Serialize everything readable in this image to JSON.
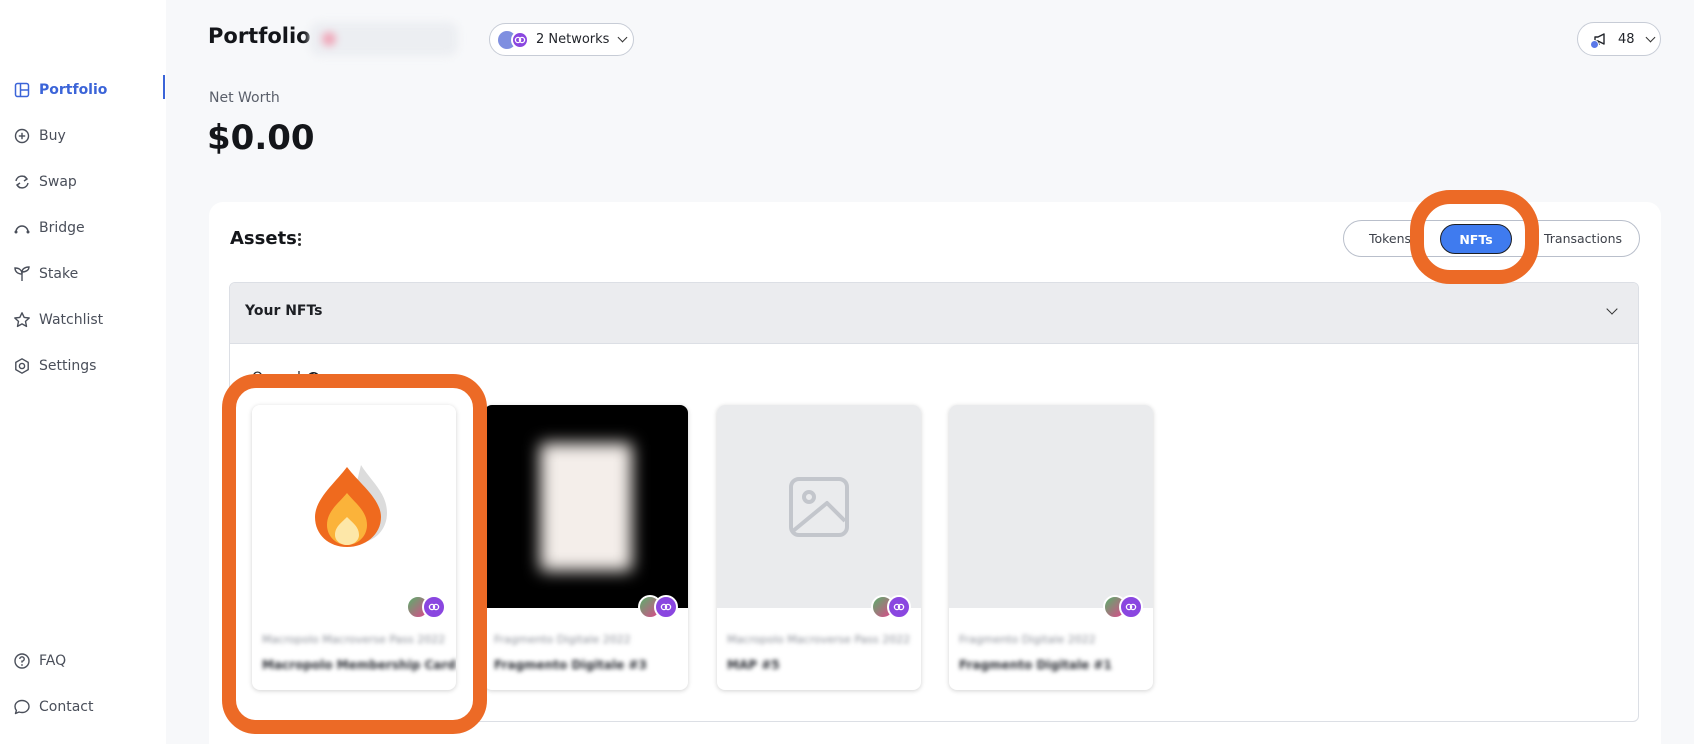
{
  "sidebar": {
    "items": [
      {
        "label": "Portfolio",
        "icon": "portfolio-icon",
        "active": true
      },
      {
        "label": "Buy",
        "icon": "plus-circle-icon"
      },
      {
        "label": "Swap",
        "icon": "swap-icon"
      },
      {
        "label": "Bridge",
        "icon": "bridge-icon"
      },
      {
        "label": "Stake",
        "icon": "sprout-icon"
      },
      {
        "label": "Watchlist",
        "icon": "star-icon"
      },
      {
        "label": "Settings",
        "icon": "gear-icon"
      }
    ],
    "bottom_items": [
      {
        "label": "FAQ",
        "icon": "question-circle-icon"
      },
      {
        "label": "Contact",
        "icon": "chat-bubble-icon"
      }
    ]
  },
  "header": {
    "title": "Portfolio",
    "networks_label": "2 Networks",
    "notifications_count": "48"
  },
  "net_worth": {
    "label": "Net Worth",
    "value": "$0.00"
  },
  "assets": {
    "title": "Assets",
    "tabs": [
      {
        "label": "Tokens"
      },
      {
        "label": "NFTs",
        "active": true
      },
      {
        "label": "Transactions"
      }
    ],
    "section_title": "Your NFTs",
    "owned_label": "Owned",
    "owned_count": "4",
    "nfts": [
      {
        "collection": "Macropolo Macroverse Pass 2022",
        "name": "Macropolo Membership Card",
        "image": "flame-logo"
      },
      {
        "collection": "Fragmento Digitale 2022",
        "name": "Fragmento Digitale #3",
        "image": "blurred-artwork"
      },
      {
        "collection": "Macropolo Macroverse Pass 2022",
        "name": "MAP #5",
        "image": "image-placeholder-icon"
      },
      {
        "collection": "Fragmento Digitale 2022",
        "name": "Fragmento Digitale #1",
        "image": "blank"
      }
    ]
  },
  "colors": {
    "accent": "#3f7bef",
    "sidebar_active": "#3b64d8",
    "highlight": "#ec6a26",
    "chain_purple": "#8a46e0"
  }
}
